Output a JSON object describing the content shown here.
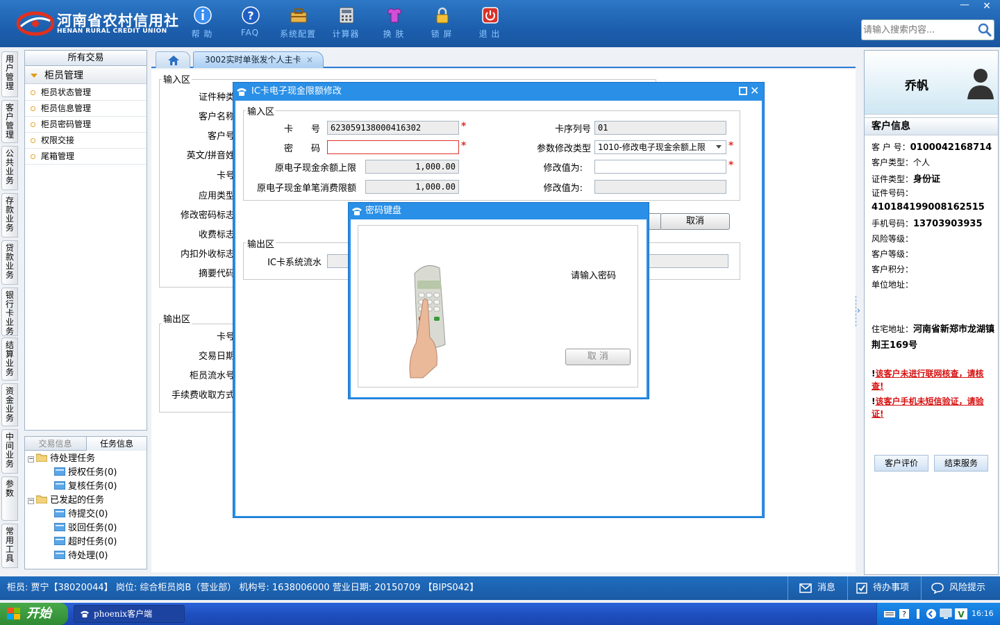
{
  "header": {
    "logo_cn": "河南省农村信用社",
    "logo_en": "HENAN RURAL CREDIT UNION",
    "toolbar": [
      {
        "label": "帮 助",
        "icon": "info-icon"
      },
      {
        "label": "FAQ",
        "icon": "help-icon"
      },
      {
        "label": "系统配置",
        "icon": "toolbox-icon"
      },
      {
        "label": "计算器",
        "icon": "calculator-icon"
      },
      {
        "label": "换 肤",
        "icon": "shirt-icon"
      },
      {
        "label": "锁 屏",
        "icon": "lock-icon"
      },
      {
        "label": "退 出",
        "icon": "power-icon"
      }
    ],
    "search_placeholder": "请输入搜索内容...",
    "minimize": "—",
    "close": "✕"
  },
  "vnav": [
    "用户管理",
    "客户管理",
    "公共业务",
    "存款业务",
    "贷款业务",
    "银行卡业务",
    "结算业务",
    "资金业务",
    "中间业务",
    "参数",
    "常用工具"
  ],
  "leftpanel": {
    "header": "所有交易",
    "group": "柜员管理",
    "items": [
      "柜员状态管理",
      "柜员信息管理",
      "柜员密码管理",
      "权限交接",
      "尾箱管理"
    ]
  },
  "taskpanel": {
    "tabs": [
      "交易信息",
      "任务信息"
    ],
    "tree": [
      {
        "label": "待处理任务",
        "level": 0
      },
      {
        "label": "授权任务(0)",
        "level": 1
      },
      {
        "label": "复核任务(0)",
        "level": 1
      },
      {
        "label": "已发起的任务",
        "level": 0
      },
      {
        "label": "待提交(0)",
        "level": 1
      },
      {
        "label": "驳回任务(0)",
        "level": 1
      },
      {
        "label": "超时任务(0)",
        "level": 1
      },
      {
        "label": "待处理(0)",
        "level": 1
      }
    ]
  },
  "tabs": {
    "active": "3002实时单张发个人主卡",
    "close": "×"
  },
  "bgform": {
    "input_legend": "输入区",
    "input_labels": [
      "证件种类",
      "客户名称",
      "客户号",
      "英文/拼音姓",
      "卡号",
      "应用类型",
      "修改密码标志",
      "收费标志",
      "内扣外收标志",
      "摘要代码"
    ],
    "output_legend": "输出区",
    "output_labels": [
      "卡号",
      "交易日期",
      "柜员流水号",
      "手续费收取方式"
    ]
  },
  "dialog1": {
    "title": "IC卡电子现金限额修改",
    "input_legend": "输入区",
    "card_label": "卡　　号",
    "card_value": "623059138000416302",
    "pwd_label": "密　　码",
    "seq_label": "卡序列号",
    "seq_value": "01",
    "ptype_label": "参数修改类型",
    "ptype_value": "1010-修改电子现金余额上限",
    "bal_label": "原电子现金余额上限",
    "bal_value": "1,000.00",
    "new1_label": "修改值为:",
    "single_label": "原电子现金单笔消费限额",
    "single_value": "1,000.00",
    "new2_label": "修改值为:",
    "cancel": "取消",
    "output_legend": "输出区",
    "flow_label": "IC卡系统流水"
  },
  "dialog2": {
    "title": "密码键盘",
    "prompt": "请输入密码",
    "cancel": "取 消"
  },
  "customer": {
    "name": "乔帆",
    "header": "客户信息",
    "fields": [
      {
        "label": "客 户 号：",
        "value": "0100042168714"
      },
      {
        "label": "客户类型：",
        "value": "个人"
      },
      {
        "label": "证件类型：",
        "value": "身份证"
      },
      {
        "label": "证件号码：",
        "value": ""
      },
      {
        "label": "",
        "value": "410184199008162515"
      },
      {
        "label": "手机号码：",
        "value": "13703903935"
      },
      {
        "label": "风险等级：",
        "value": ""
      },
      {
        "label": "客户等级：",
        "value": ""
      },
      {
        "label": "客户积分：",
        "value": ""
      },
      {
        "label": "单位地址：",
        "value": ""
      }
    ],
    "addr_label": "住宅地址：",
    "addr_value": "河南省新郑市龙湖镇荆王169号",
    "warn1_bang": "!",
    "warn1": "该客户未进行联网核查，请核查!",
    "warn2_bang": "!",
    "warn2": "该客户手机未短信验证，请验证!",
    "btn_eval": "客户评价",
    "btn_end": "结束服务"
  },
  "status": {
    "text": "柜员: 贾宁【38020044】 岗位: 综合柜员岗B（营业部）  机构号: 1638006000  营业日期: 20150709 【BIPS042】",
    "msg": "消息",
    "todo": "待办事项",
    "risk": "风险提示"
  },
  "taskbar": {
    "start": "开始",
    "app": "phoenix客户端",
    "clock": "16:16"
  },
  "colors": {
    "accent": "#1c5fae",
    "dialog": "#2a8fe6",
    "error": "#e0302a"
  }
}
